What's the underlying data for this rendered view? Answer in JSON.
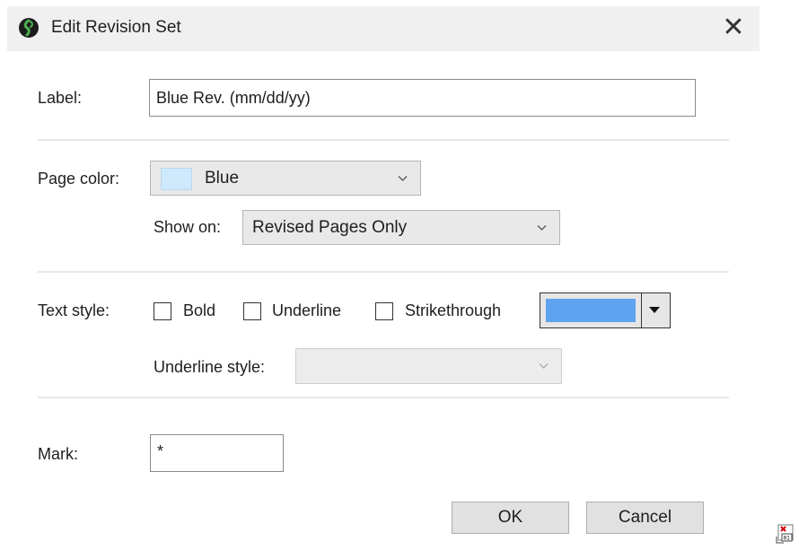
{
  "window": {
    "title": "Edit Revision Set",
    "close_glyph": "✕",
    "icon": "app-logo-icon"
  },
  "label_field": {
    "label": "Label:",
    "value": "Blue Rev. (mm/dd/yy)"
  },
  "page_color": {
    "label": "Page color:",
    "selected": "Blue",
    "swatch_color": "#cde9fb",
    "show_on_label": "Show on:",
    "show_on_selected": "Revised Pages Only"
  },
  "text_style": {
    "label": "Text style:",
    "bold_label": "Bold",
    "bold_checked": false,
    "underline_label": "Underline",
    "underline_checked": false,
    "strikethrough_label": "Strikethrough",
    "strikethrough_checked": false,
    "color": "#5da3ef",
    "underline_style_label": "Underline style:",
    "underline_style_selected": ""
  },
  "mark": {
    "label": "Mark:",
    "value": "*"
  },
  "buttons": {
    "ok": "OK",
    "cancel": "Cancel"
  }
}
